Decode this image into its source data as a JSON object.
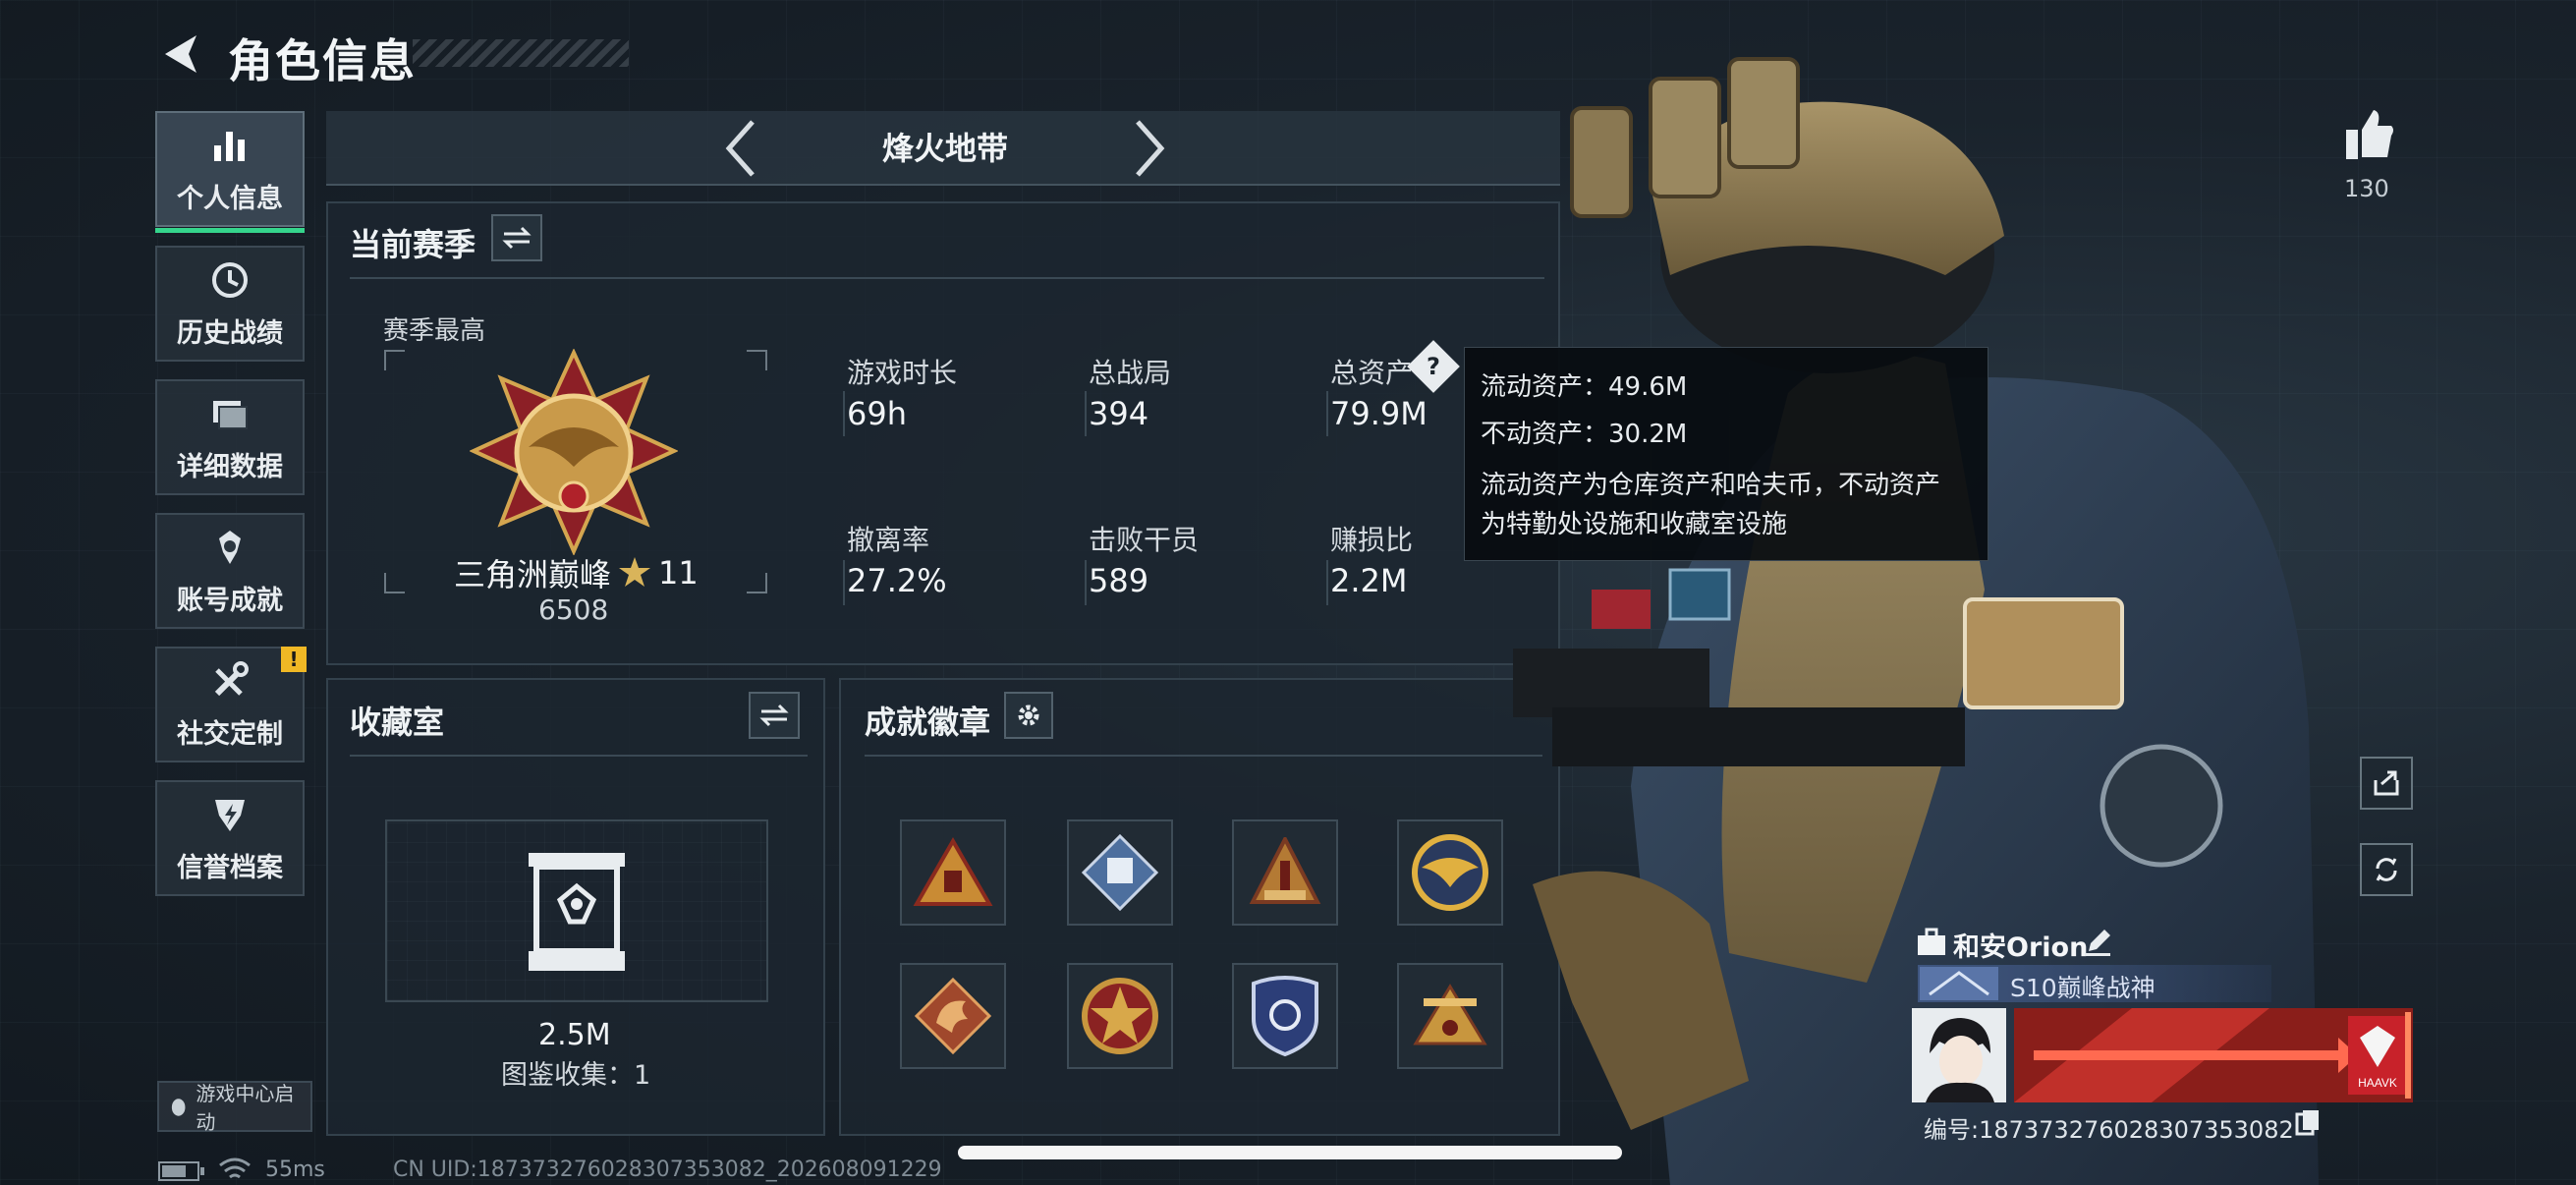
{
  "header": {
    "title": "角色信息"
  },
  "nav": {
    "items": [
      {
        "label": "个人信息",
        "icon": "bar-chart-icon",
        "active": true
      },
      {
        "label": "历史战绩",
        "icon": "history-icon"
      },
      {
        "label": "详细数据",
        "icon": "folder-icon"
      },
      {
        "label": "账号成就",
        "icon": "achievement-medal-icon"
      },
      {
        "label": "社交定制",
        "icon": "tools-icon",
        "badge": "!"
      },
      {
        "label": "信誉档案",
        "icon": "credit-shield-icon"
      }
    ],
    "game_center": "游戏中心启动"
  },
  "mode": {
    "title": "烽火地带"
  },
  "season": {
    "title": "当前赛季",
    "best_label": "赛季最高",
    "rank_name": "三角洲巅峰",
    "rank_stars": "11",
    "rank_points": "6508",
    "stats": [
      {
        "label": "游戏时长",
        "value": "69h"
      },
      {
        "label": "总战局",
        "value": "394"
      },
      {
        "label": "总资产",
        "value": "79.9M",
        "help": "?"
      },
      {
        "label": "撤离率",
        "value": "27.2%"
      },
      {
        "label": "击败干员",
        "value": "589"
      },
      {
        "label": "赚损比",
        "value": "2.2M"
      }
    ]
  },
  "tooltip": {
    "line1": "流动资产：49.6M",
    "line2": "不动资产：30.2M",
    "desc_line1": "流动资产为仓库资产和哈夫币，不动资产",
    "desc_line2": "为特勤处设施和收藏室设施"
  },
  "collection": {
    "title": "收藏室",
    "value": "2.5M",
    "collected": "图鉴收集：1"
  },
  "achievements": {
    "title": "成就徽章",
    "badges": [
      "triangle-gold-badge",
      "dice-diamond-badge",
      "tower-badge",
      "eagle-emblem-badge",
      "dragon-badge",
      "star-compass-badge",
      "police-shield-badge",
      "crown-tower-badge"
    ]
  },
  "profile": {
    "likes": "130",
    "player_name": "和安Orion",
    "rank_title": "S10巅峰战神",
    "uid": "编号:187373276028307353082",
    "card_brand": "HAAVK"
  },
  "status": {
    "ping": "55ms",
    "uid_footer": "CN UID:187373276028307353082_202608091229"
  },
  "colors": {
    "accent_green": "#35d58c",
    "badge_yellow": "#f0b825"
  }
}
